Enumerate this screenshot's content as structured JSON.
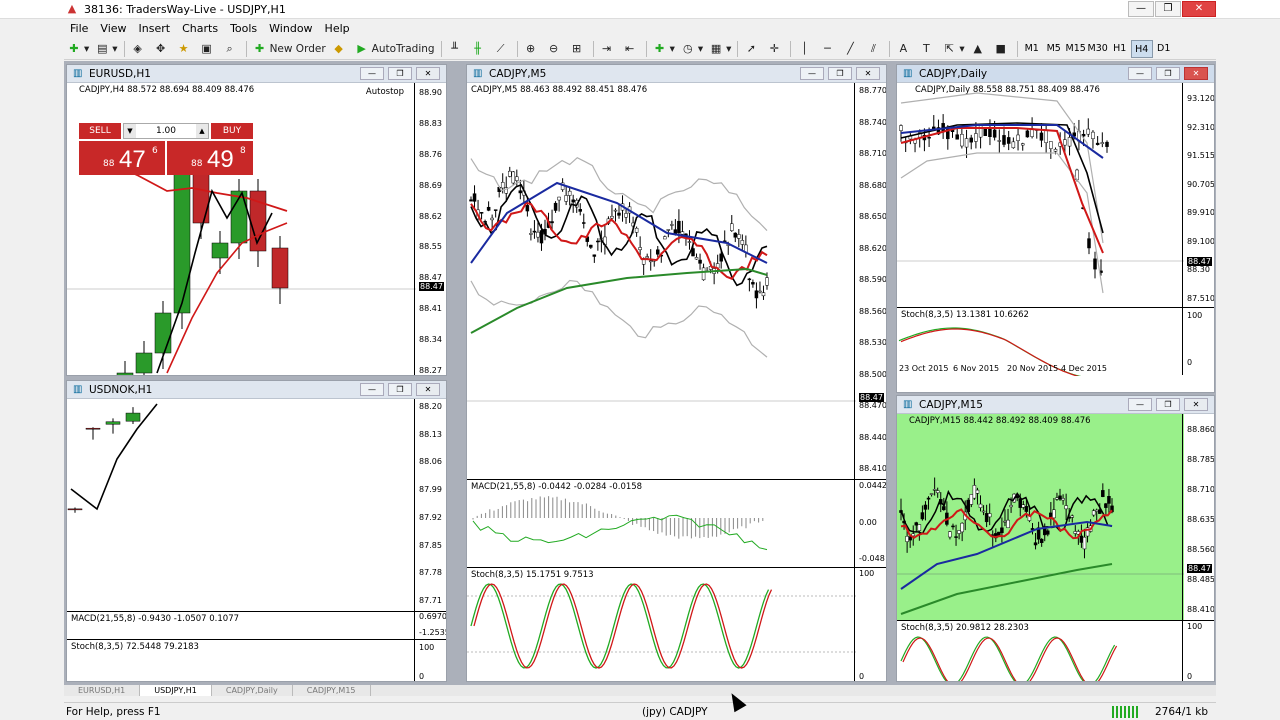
{
  "window": {
    "id_title": "38136: TradersWay-Live - USDJPY,H1"
  },
  "menu": [
    "File",
    "View",
    "Insert",
    "Charts",
    "Tools",
    "Window",
    "Help"
  ],
  "toolbar": {
    "new_order": "New Order",
    "autotrading": "AutoTrading",
    "timeframes": [
      "M1",
      "M5",
      "M15",
      "M30",
      "H1",
      "H4",
      "D1"
    ],
    "active_tf": "H4"
  },
  "charts": {
    "eurusd": {
      "title": "EURUSD,H1",
      "info": "CADJPY,H4  88.572 88.694 88.409 88.476",
      "autostop": "Autostop",
      "trade": {
        "sell": "SELL",
        "buy": "BUY",
        "lot": "1.00",
        "sell_small": "88",
        "sell_big": "47",
        "sell_pip": "6",
        "buy_small": "88",
        "buy_big": "49",
        "buy_pip": "8"
      },
      "axis": [
        "88.90",
        "88.83",
        "88.76",
        "88.69",
        "88.62",
        "88.55",
        "88.47",
        "88.41",
        "88.34",
        "88.27"
      ],
      "current": "88.47"
    },
    "usdnok": {
      "title": "USDNOK,H1",
      "axis": [
        "88.20",
        "88.13",
        "88.06",
        "87.99",
        "87.92",
        "87.85",
        "87.78",
        "87.71"
      ],
      "macd": "MACD(21,55,8) -0.9430 -1.0507 0.1077",
      "macd_axis": [
        "0.6970",
        "-1.2535"
      ],
      "stoch": "Stoch(8,3,5) 72.5448 79.2183",
      "stoch_axis": [
        "100",
        "0"
      ]
    },
    "cadjpy_m5": {
      "title": "CADJPY,M5",
      "info": "CADJPY,M5  88.463 88.492 88.451 88.476",
      "axis": [
        "88.770",
        "88.740",
        "88.710",
        "88.680",
        "88.650",
        "88.620",
        "88.590",
        "88.560",
        "88.530",
        "88.500",
        "88.470",
        "88.440",
        "88.410"
      ],
      "current": "88.47",
      "macd": "MACD(21,55,8) -0.0442 -0.0284 -0.0158",
      "macd_axis": [
        "0.0442",
        "0.00",
        "-0.048"
      ],
      "stoch": "Stoch(8,3,5) 15.1751 9.7513",
      "stoch_axis": [
        "100",
        "0"
      ]
    },
    "cadjpy_daily": {
      "title": "CADJPY,Daily",
      "info": "CADJPY,Daily  88.558 88.751 88.409 88.476",
      "axis": [
        "93.120",
        "92.310",
        "91.515",
        "90.705",
        "89.910",
        "89.100",
        "88.30",
        "87.510"
      ],
      "current": "88.47",
      "stoch": "Stoch(8,3,5) 13.1381 10.6262",
      "stoch_axis": [
        "100",
        "0"
      ],
      "dates": [
        "23 Oct 2015",
        "6 Nov 2015",
        "20 Nov 2015",
        "4 Dec 2015"
      ]
    },
    "cadjpy_m15": {
      "title": "CADJPY,M15",
      "info": "CADJPY,M15  88.442 88.492 88.409 88.476",
      "axis": [
        "88.860",
        "88.785",
        "88.710",
        "88.635",
        "88.560",
        "88.485",
        "88.410"
      ],
      "current": "88.47",
      "stoch": "Stoch(8,3,5) 20.9812 28.2303",
      "stoch_axis": [
        "100",
        "0"
      ]
    }
  },
  "tabs": [
    "EURUSD,H1",
    "USDJPY,H1",
    "CADJPY,Daily",
    "CADJPY,M15"
  ],
  "status": {
    "help": "For Help, press F1",
    "symbol": "(jpy) CADJPY",
    "traffic": "2764/1 kb"
  },
  "colors": {
    "bull": "#2a9a2a",
    "bear": "#c0282a",
    "ma_red": "#d01818",
    "ma_blue": "#1a2aa0",
    "ma_green": "#2a8a2a",
    "m15_bg": "#99f08a"
  }
}
